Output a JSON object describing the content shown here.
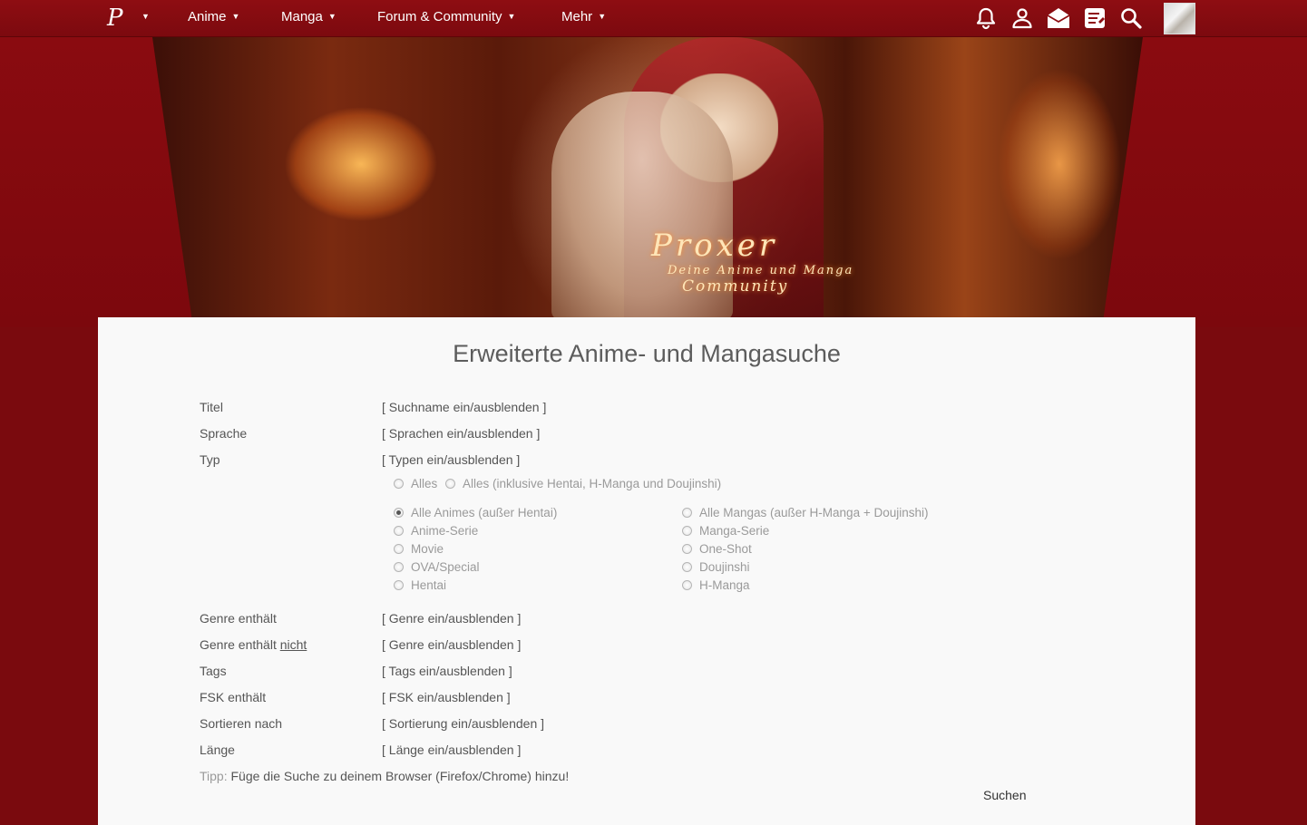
{
  "nav": {
    "logo": "P",
    "items": [
      {
        "label": "Anime"
      },
      {
        "label": "Manga"
      },
      {
        "label": "Forum & Community"
      },
      {
        "label": "Mehr"
      }
    ],
    "icons": [
      "bell-icon",
      "user-icon",
      "envelope-icon",
      "news-icon",
      "search-icon"
    ]
  },
  "banner": {
    "brand": "Proxer",
    "tagline": "Deine Anime und Manga",
    "tagline2": "Community"
  },
  "page": {
    "title": "Erweiterte Anime- und Mangasuche"
  },
  "fields": [
    {
      "label": "Titel",
      "toggle": "[ Suchname ein/ausblenden ]"
    },
    {
      "label": "Sprache",
      "toggle": "[ Sprachen ein/ausblenden ]"
    },
    {
      "label": "Typ",
      "toggle": "[ Typen ein/ausblenden ]"
    },
    {
      "label": "Genre enthält",
      "toggle": "[ Genre ein/ausblenden ]"
    },
    {
      "label": "Genre enthält",
      "label_underlined": "nicht",
      "toggle": "[ Genre ein/ausblenden ]"
    },
    {
      "label": "Tags",
      "toggle": "[ Tags ein/ausblenden ]"
    },
    {
      "label": "FSK enthält",
      "toggle": "[ FSK ein/ausblenden ]"
    },
    {
      "label": "Sortieren nach",
      "toggle": "[ Sortierung ein/ausblenden ]"
    },
    {
      "label": "Länge",
      "toggle": "[ Länge ein/ausblenden ]"
    }
  ],
  "type_options": {
    "top": [
      "Alles",
      "Alles (inklusive Hentai, H-Manga und Doujinshi)"
    ],
    "anime": [
      "Alle Animes (außer Hentai)",
      "Anime-Serie",
      "Movie",
      "OVA/Special",
      "Hentai"
    ],
    "manga": [
      "Alle Mangas (außer H-Manga + Doujinshi)",
      "Manga-Serie",
      "One-Shot",
      "Doujinshi",
      "H-Manga"
    ],
    "selected": "Alle Animes (außer Hentai)"
  },
  "tip": {
    "label": "Tipp:",
    "text": "Füge die Suche zu deinem Browser (Firefox/Chrome) hinzu!"
  },
  "search_button": "Suchen",
  "colors": {
    "nav_bg": "#8e0d12",
    "page_bg": "#7a0a0e",
    "panel_bg": "#f9f9f9"
  }
}
